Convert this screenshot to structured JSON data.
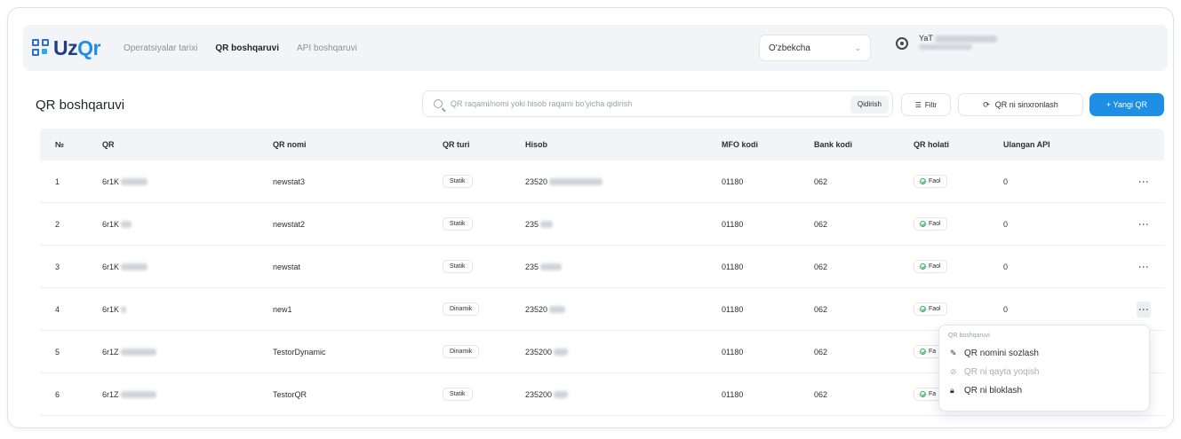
{
  "app": {
    "logo_uz": "Uz",
    "logo_qr": "Qr"
  },
  "nav": {
    "items": [
      {
        "label": "Operatsiyalar tarixi",
        "active": false
      },
      {
        "label": "QR boshqaruvi",
        "active": true
      },
      {
        "label": "API boshqaruvi",
        "active": false
      }
    ]
  },
  "language": {
    "selected": "O'zbekcha"
  },
  "user": {
    "name": "YaT"
  },
  "page": {
    "title": "QR boshqaruvi"
  },
  "search": {
    "placeholder": "QR raqami/nomi yoki hisob raqami bo'yicha qidirish",
    "button": "Qidirish"
  },
  "toolbar": {
    "filter": "Filtr",
    "sync": "QR ni sinxronlash",
    "new": "+ Yangi QR"
  },
  "table": {
    "headers": [
      "№",
      "QR",
      "QR nomi",
      "QR turi",
      "Hisob",
      "MFO kodi",
      "Bank kodi",
      "QR holati",
      "Ulangan API"
    ],
    "rows": [
      {
        "no": "1",
        "qr": "6r1K",
        "name": "newstat3",
        "type": "Statik",
        "account": "23520",
        "mfo": "01180",
        "bank": "062",
        "status": "Faol",
        "api": "0"
      },
      {
        "no": "2",
        "qr": "6r1K",
        "name": "newstat2",
        "type": "Statik",
        "account": "235",
        "mfo": "01180",
        "bank": "062",
        "status": "Faol",
        "api": "0"
      },
      {
        "no": "3",
        "qr": "6r1K",
        "name": "newstat",
        "type": "Statik",
        "account": "235",
        "mfo": "01180",
        "bank": "062",
        "status": "Faol",
        "api": "0"
      },
      {
        "no": "4",
        "qr": "6r1K",
        "name": "new1",
        "type": "Dinamik",
        "account": "23520",
        "mfo": "01180",
        "bank": "062",
        "status": "Faol",
        "api": "0"
      },
      {
        "no": "5",
        "qr": "6r1Z",
        "name": "TestorDynamic",
        "type": "Dinamik",
        "account": "235200",
        "mfo": "01180",
        "bank": "062",
        "status": "Fa",
        "api": ""
      },
      {
        "no": "6",
        "qr": "6r1Z",
        "name": "TestorQR",
        "type": "Statik",
        "account": "235200",
        "mfo": "01180",
        "bank": "062",
        "status": "Fa",
        "api": ""
      }
    ]
  },
  "menu": {
    "title": "QR boshqaruvi",
    "items": [
      {
        "label": "QR nomini sozlash",
        "icon": "pencil-icon",
        "disabled": false
      },
      {
        "label": "QR ni qayta yoqish",
        "icon": "restart-icon",
        "disabled": true
      },
      {
        "label": "QR ni bloklash",
        "icon": "lock-icon",
        "disabled": false
      }
    ]
  },
  "colors": {
    "brand_blue": "#1f8fe6",
    "brand_dark": "#1f3c88",
    "status_green": "#2fb35a"
  }
}
